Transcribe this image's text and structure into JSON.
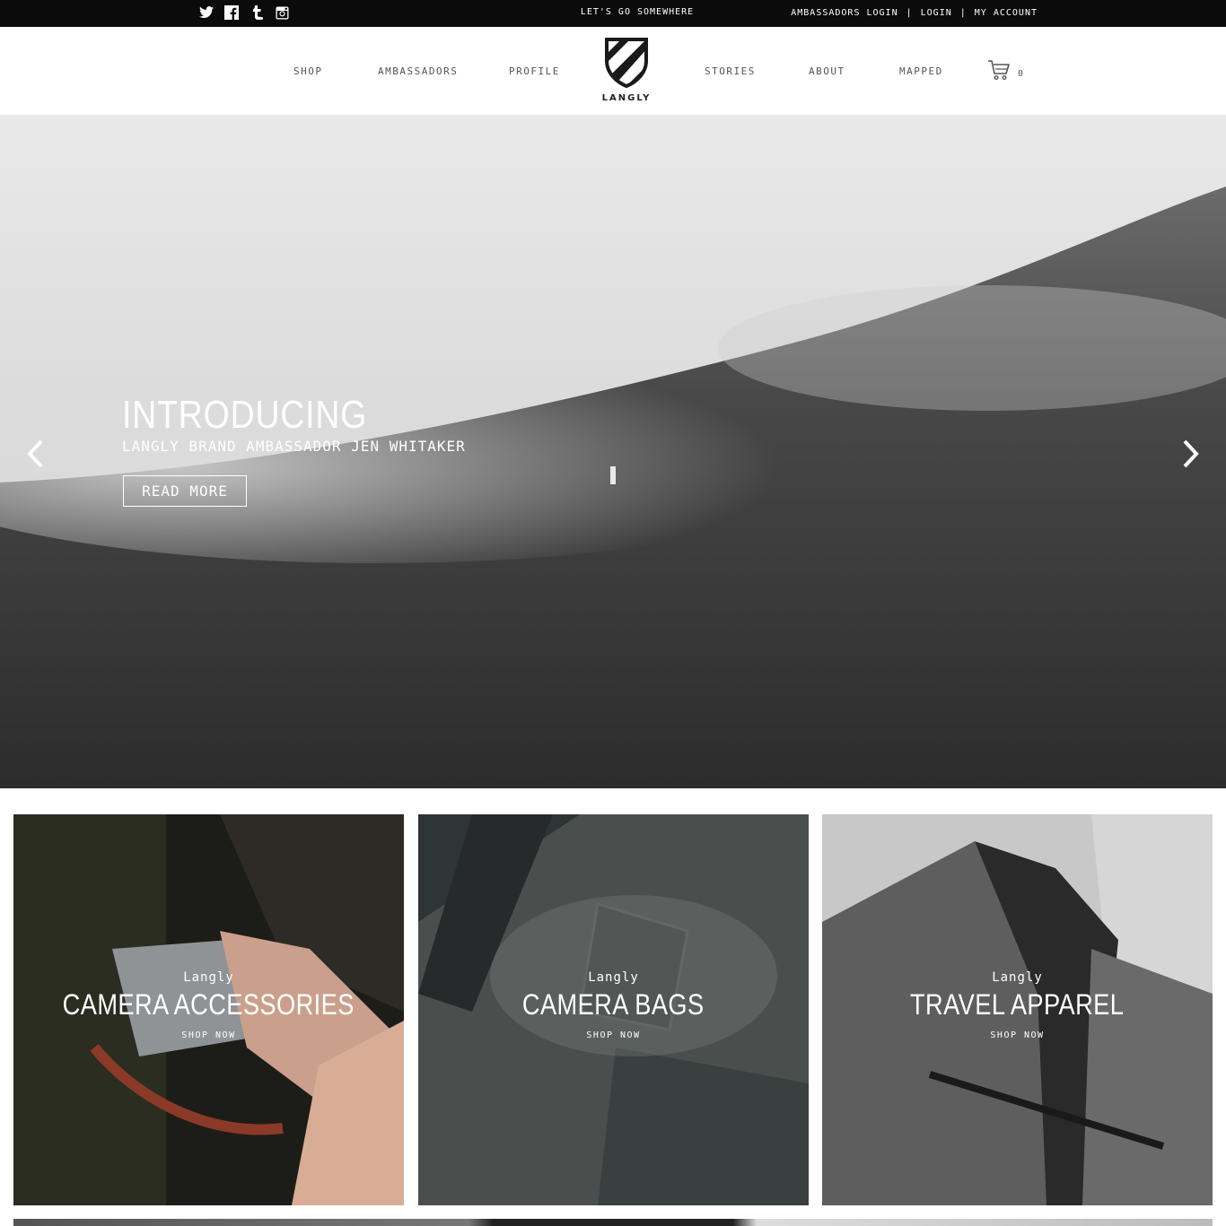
{
  "topbar": {
    "social": [
      "twitter-icon",
      "facebook-icon",
      "tumblr-icon",
      "instagram-icon"
    ],
    "tagline": "LET'S GO SOMEWHERE",
    "ambassadors_login": "AMBASSADORS LOGIN",
    "separator": "|",
    "login": "LOGIN",
    "my_account": "MY ACCOUNT"
  },
  "nav": {
    "items": [
      "SHOP",
      "AMBASSADORS",
      "PROFILE",
      "STORIES",
      "ABOUT",
      "MAPPED"
    ],
    "logo_text": "LANGLY",
    "cart_count": "0"
  },
  "hero": {
    "title": "INTRODUCING",
    "subtitle": "LANGLY BRAND AMBASSADOR JEN WHITAKER",
    "button": "READ MORE"
  },
  "tiles": [
    {
      "brand": "Langly",
      "name": "CAMERA ACCESSORIES",
      "cta": "SHOP NOW"
    },
    {
      "brand": "Langly",
      "name": "CAMERA BAGS",
      "cta": "SHOP NOW"
    },
    {
      "brand": "Langly",
      "name": "TRAVEL APPAREL",
      "cta": "SHOP NOW"
    }
  ],
  "colors": {
    "topbar": "#0b0b0b",
    "text": "#555555",
    "white": "#ffffff"
  }
}
